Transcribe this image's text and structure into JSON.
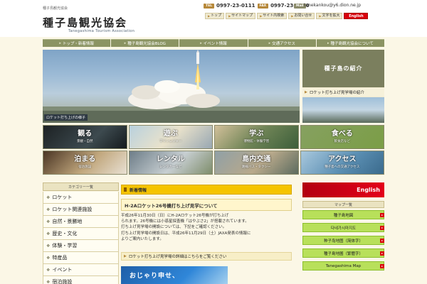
{
  "header": {
    "tagline": "種子島観光協会",
    "logo": "種子島観光協会",
    "logo_sub": "Tanegashima Tourism Association",
    "tel_label": "TEL",
    "tel": "0997-23-0111",
    "fax_label": "FAX",
    "fax": "0997-23-0770",
    "mail_label": "Mail",
    "mail": "tanekankou@y6.dion.ne.jp"
  },
  "util_nav": [
    {
      "label": "トップ"
    },
    {
      "label": "サイトマップ"
    },
    {
      "label": "サイト内検索"
    },
    {
      "label": "お問い合せ"
    },
    {
      "label": "文字を拡大"
    }
  ],
  "english_button": "English",
  "main_nav": [
    {
      "label": "トップ・新着情報"
    },
    {
      "label": "種子島観光協会BLOG"
    },
    {
      "label": "イベント情報"
    },
    {
      "label": "交通アクセス"
    },
    {
      "label": "種子島観光協会について"
    }
  ],
  "hero": {
    "caption": "ロケット打ち上げの様子"
  },
  "side_banner": {
    "title": "種子島の紹介",
    "link": "ロケット打ち上げ見学場の紹介"
  },
  "categories": [
    {
      "big": "観る",
      "small": "景観・自然"
    },
    {
      "big": "遊ぶ",
      "small": "マリンレジャー"
    },
    {
      "big": "学ぶ",
      "small": "博物館・体験学習"
    },
    {
      "big": "食べる",
      "small": "飲食店など"
    },
    {
      "big": "泊まる",
      "small": "宿泊施設"
    },
    {
      "big": "レンタル",
      "small": "レンタカーなど"
    },
    {
      "big": "島内交通",
      "small": "路線バス・タクシー"
    },
    {
      "big": "アクセス",
      "small": "種子島への交通アクセス"
    }
  ],
  "left_sidebar": {
    "heading": "カテゴリー一覧",
    "items": [
      {
        "label": "ロケット"
      },
      {
        "label": "ロケット関連施設"
      },
      {
        "label": "自然・景勝地"
      },
      {
        "label": "歴史・文化"
      },
      {
        "label": "体験・学習"
      },
      {
        "label": "特産品"
      },
      {
        "label": "イベント"
      },
      {
        "label": "宿泊施設"
      }
    ]
  },
  "news": {
    "heading": "新着情報",
    "title": "H-2Aロケット26号機打ち上げ見学について",
    "body": [
      "平成26年11月30日（日）にH-2Aロケット26号機が打ち上げ",
      "られます。26号機には小惑星探査機「はやぶさ2」が搭載されています。",
      "打ち上げ見学場の開設については、下記をご確認ください。",
      "打ち上げ見学場の開設日は、平成26年11月29日（土）JAXA発表の情報に",
      "よりご案内いたします。"
    ],
    "link": "ロケット打ち上げ見学場の詳細はこちらをご覧ください"
  },
  "banner_ojari": "おじゃり申せ、",
  "right_sidebar": {
    "english_banner": "English",
    "heading": "マップ一覧",
    "items": [
      {
        "label": "種子島地図"
      },
      {
        "label": "다네가시마지도"
      },
      {
        "label": "种子岛地图（简体字）"
      },
      {
        "label": "種子島地圖（繁體字）"
      },
      {
        "label": "Tanegashima Map"
      }
    ]
  },
  "colors": {
    "accent_red": "#d9000b",
    "nav_olive": "#8b9463",
    "news_yellow": "#f5c400",
    "map_green": "#b8e05a"
  }
}
